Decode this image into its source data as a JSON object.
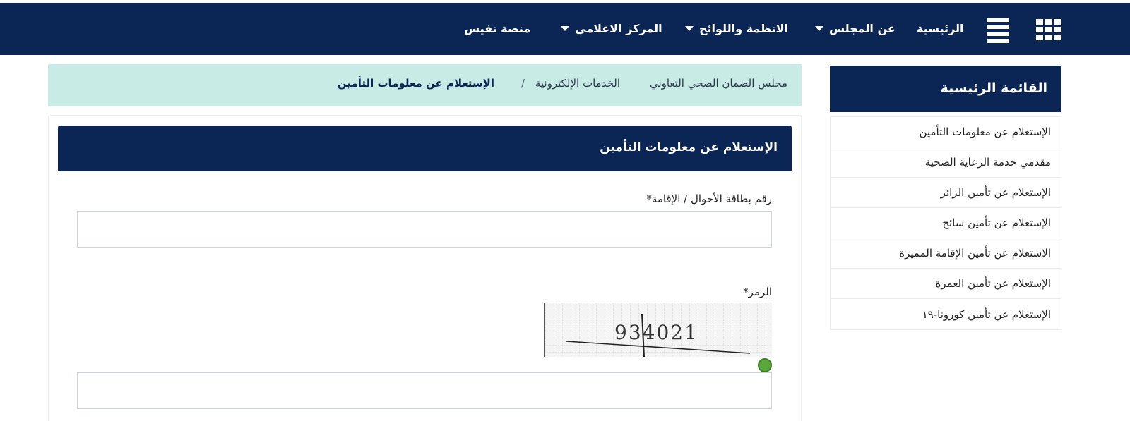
{
  "nav": {
    "items": [
      {
        "label": "الرئيسية",
        "has_caret": false
      },
      {
        "label": "عن المجلس",
        "has_caret": true
      },
      {
        "label": "الانظمة واللوائح",
        "has_caret": true
      },
      {
        "label": "المركز الاعلامي",
        "has_caret": true
      },
      {
        "label": "منصة نفيس",
        "has_caret": false
      }
    ],
    "icons": [
      "apps-grid-icon",
      "hamburger-menu-icon",
      "caret-down-icon"
    ]
  },
  "breadcrumb": {
    "items": [
      "مجلس الضمان الصحي التعاوني",
      "الخدمات الإلكترونية"
    ],
    "separator": "/",
    "current": "الإستعلام عن معلومات التأمين"
  },
  "form": {
    "title": "الإستعلام عن معلومات التأمين",
    "id_label": "رقم بطاقة الأحوال / الإقامة*",
    "id_value": "",
    "captcha_label": "الرمز*",
    "captcha_text": "934021",
    "captcha_value": "",
    "refresh_icon": "refresh-icon"
  },
  "sidebar": {
    "title": "القائمة الرئيسية",
    "items": [
      {
        "label": "الإستعلام عن معلومات التأمين"
      },
      {
        "label": "مقدمي خدمة الرعاية الصحية"
      },
      {
        "label": "الإستعلام عن تأمين الزائر"
      },
      {
        "label": "الإستعلام عن تأمين سائح"
      },
      {
        "label": "الاستعلام عن تأمين الإقامة المميزة"
      },
      {
        "label": "الإستعلام عن تأمين العمرة"
      },
      {
        "label": "الإستعلام عن تأمين كورونا-١٩"
      }
    ]
  },
  "colors": {
    "primary": "#0b2555",
    "breadcrumb_bg": "#c8ebe6",
    "refresh": "#5aa83c"
  }
}
